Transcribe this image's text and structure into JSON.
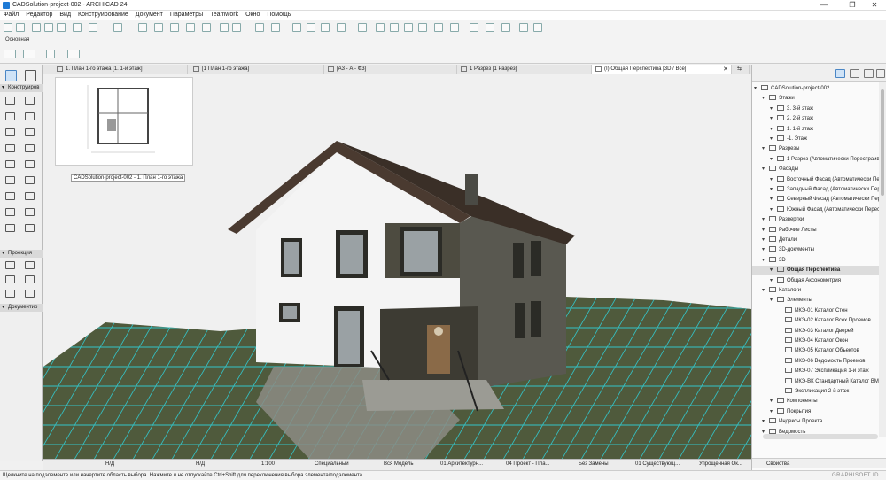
{
  "window": {
    "title": "CADSolution-project-002 - ARCHICAD 24"
  },
  "menu": [
    "Файл",
    "Редактор",
    "Вид",
    "Конструирование",
    "Документ",
    "Параметры",
    "Teamwork",
    "Окно",
    "Помощь"
  ],
  "infobox": {
    "label": "Основная"
  },
  "tabs": [
    {
      "label": "1. План 1-го этажа [1. 1-й этаж]"
    },
    {
      "label": "[1 План 1-го этажа]"
    },
    {
      "label": "[А3 - А - Ф3]"
    },
    {
      "label": "1 Разрез [1 Разрез]"
    },
    {
      "label": "(I) Общая Перспектива [3D / Все]"
    }
  ],
  "toolbox": {
    "sections": [
      "Конструиров",
      "Проекция",
      "Документир"
    ]
  },
  "thumbnail": {
    "caption": "CADSolution-project-002 - 1. План 1-го этажа"
  },
  "statusbar": {
    "zoom1": "Н/Д",
    "zoom2": "Н/Д",
    "scale": "1:100",
    "layer": "Специальный",
    "model": "Вся Модель",
    "pen": "01 Архитектурн...",
    "mvo": "04 Проект - Пла...",
    "reno": "Без Замены",
    "renofilter": "01 Существующ...",
    "style": "Упрощенная Ок..."
  },
  "status_message": "Щелкните на подэлементе или начертите область выбора. Нажмите и не отпускайте Ctrl+Shift для переключения выбора элемента/подэлемента.",
  "brand": "GRAPHISOFT ID",
  "navigator": {
    "items": [
      {
        "label": "CADSolution-project-002",
        "level": 0
      },
      {
        "label": "Этажи",
        "level": 1
      },
      {
        "label": "3. 3-й этаж",
        "level": 2
      },
      {
        "label": "2. 2-й этаж",
        "level": 2
      },
      {
        "label": "1. 1-й этаж",
        "level": 2
      },
      {
        "label": "-1. Этаж",
        "level": 2
      },
      {
        "label": "Разрезы",
        "level": 1
      },
      {
        "label": "1 Разрез (Автоматически Перестраива",
        "level": 2
      },
      {
        "label": "Фасады",
        "level": 1
      },
      {
        "label": "Восточный Фасад (Автоматически Перест",
        "level": 2
      },
      {
        "label": "Западный Фасад (Автоматически Перес",
        "level": 2
      },
      {
        "label": "Северный Фасад (Автоматически Перест",
        "level": 2
      },
      {
        "label": "Южный Фасад (Автоматически Перестр",
        "level": 2
      },
      {
        "label": "Развертки",
        "level": 1
      },
      {
        "label": "Рабочие Листы",
        "level": 1
      },
      {
        "label": "Детали",
        "level": 1
      },
      {
        "label": "3D-документы",
        "level": 1
      },
      {
        "label": "3D",
        "level": 1
      },
      {
        "label": "Общая Перспектива",
        "level": 2,
        "selected": true
      },
      {
        "label": "Общая Аксонометрия",
        "level": 2
      },
      {
        "label": "Каталоги",
        "level": 1
      },
      {
        "label": "Элементы",
        "level": 2
      },
      {
        "label": "ИКЭ-01 Каталог Стен",
        "level": 3
      },
      {
        "label": "ИКЭ-02 Каталог Всех Проемов",
        "level": 3
      },
      {
        "label": "ИКЭ-03 Каталог Дверей",
        "level": 3
      },
      {
        "label": "ИКЭ-04 Каталог Окон",
        "level": 3
      },
      {
        "label": "ИКЭ-05 Каталог Объектов",
        "level": 3
      },
      {
        "label": "ИКЭ-06 Ведомость Проемов",
        "level": 3
      },
      {
        "label": "ИКЭ-07 Экспликация 1-й этаж",
        "level": 3
      },
      {
        "label": "ИКЭ-ВК Стандартный Каталог BMx",
        "level": 3
      },
      {
        "label": "Экспликация 2-й этаж",
        "level": 3
      },
      {
        "label": "Компоненты",
        "level": 2
      },
      {
        "label": "Покрытия",
        "level": 2
      },
      {
        "label": "Индексы Проекта",
        "level": 1
      },
      {
        "label": "Ведомость",
        "level": 1
      }
    ],
    "properties_label": "Свойства"
  },
  "colors": {
    "grid": "#2fd0d8",
    "roof": "#4a3a30",
    "wall": "#f4f4f4",
    "trim": "#4d4b40"
  }
}
